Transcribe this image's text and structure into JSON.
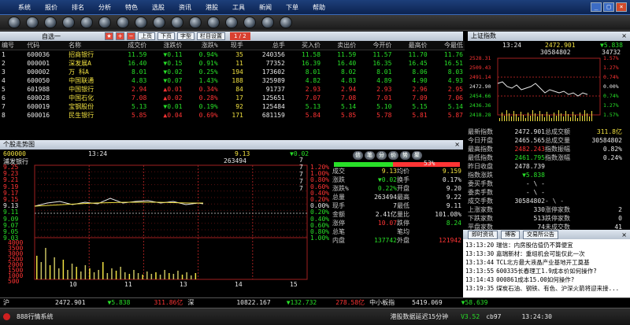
{
  "menu": [
    "系统",
    "报价",
    "排名",
    "分析",
    "特色",
    "选股",
    "资讯",
    "港股",
    "工具",
    "新闻",
    "下单",
    "帮助"
  ],
  "qtool": {
    "select": "自选一",
    "btn_up": "上页",
    "btn_down": "下页",
    "btn_font": "字型",
    "btn_cols": "栏目设置",
    "page": "1 / 2"
  },
  "quotes": {
    "headers": [
      "编号",
      "代码",
      "名称",
      "成交价",
      "涨跌价",
      "涨跌%",
      "现手",
      "总手",
      "买入价",
      "卖出价",
      "今开价",
      "最高价",
      "今最低"
    ],
    "rows": [
      {
        "no": "1",
        "code": "600036",
        "name": "招商银行",
        "price": "11.59",
        "chg": "▼0.11",
        "pct": "0.94%",
        "vol": "35",
        "total": "240356",
        "bid": "11.58",
        "ask": "11.59",
        "open": "11.57",
        "high": "11.70",
        "low": "11.76"
      },
      {
        "no": "2",
        "code": "000001",
        "name": "深发展A",
        "price": "16.40",
        "chg": "▼0.15",
        "pct": "0.91%",
        "vol": "11",
        "total": "77352",
        "bid": "16.39",
        "ask": "16.40",
        "open": "16.35",
        "high": "16.45",
        "low": "16.51"
      },
      {
        "no": "3",
        "code": "000002",
        "name": "万 科A",
        "price": "8.01",
        "chg": "▼0.02",
        "pct": "0.25%",
        "vol": "194",
        "total": "173602",
        "bid": "8.01",
        "ask": "8.02",
        "open": "8.01",
        "high": "8.06",
        "low": "8.03"
      },
      {
        "no": "4",
        "code": "600050",
        "name": "中国联通",
        "price": "4.83",
        "chg": "▼0.07",
        "pct": "1.43%",
        "vol": "188",
        "total": "325989",
        "bid": "4.82",
        "ask": "4.83",
        "open": "4.89",
        "high": "4.90",
        "low": "4.93"
      },
      {
        "no": "5",
        "code": "601988",
        "name": "中国银行",
        "price": "2.94",
        "chg": "▲0.01",
        "pct": "0.34%",
        "vol": "84",
        "total": "91737",
        "bid": "2.93",
        "ask": "2.94",
        "open": "2.93",
        "high": "2.96",
        "low": "2.95"
      },
      {
        "no": "6",
        "code": "600028",
        "name": "中国石化",
        "price": "7.08",
        "chg": "▲0.02",
        "pct": "0.28%",
        "vol": "17",
        "total": "125651",
        "bid": "7.07",
        "ask": "7.08",
        "open": "7.01",
        "high": "7.09",
        "low": "7.06"
      },
      {
        "no": "7",
        "code": "600019",
        "name": "宝钢股份",
        "price": "5.13",
        "chg": "▼0.01",
        "pct": "0.19%",
        "vol": "92",
        "total": "125484",
        "bid": "5.13",
        "ask": "5.14",
        "open": "5.10",
        "high": "5.15",
        "low": "5.14"
      },
      {
        "no": "8",
        "code": "600016",
        "name": "民生银行",
        "price": "5.85",
        "chg": "▲0.04",
        "pct": "0.69%",
        "vol": "171",
        "total": "681159",
        "bid": "5.84",
        "ask": "5.85",
        "open": "5.78",
        "high": "5.81",
        "low": "5.87"
      }
    ]
  },
  "mini": {
    "title": "个股走势图",
    "code": "600000",
    "name": "浦发银行",
    "time": "13:24",
    "price": "9.13",
    "vol": "263494",
    "chg": "▼0.02",
    "ylabels": [
      "9.25",
      "9.23",
      "9.21",
      "9.19",
      "9.17",
      "9.15",
      "9.13",
      "9.11",
      "9.09",
      "9.07",
      "9.05",
      "9.03"
    ],
    "pct_labels": [
      "1.20%",
      "1.00%",
      "0.80%",
      "0.60%",
      "0.40%",
      "0.20%",
      "0.00%",
      "0.20%",
      "0.40%",
      "0.60%",
      "0.80%",
      "1.00%"
    ],
    "vlabels": [
      "4000",
      "3500",
      "3000",
      "2500",
      "2000",
      "1500",
      "1000",
      "500"
    ],
    "xlabels": [
      "10",
      "11",
      "13",
      "14",
      "15"
    ],
    "num7": [
      "7",
      "7",
      "7",
      "7",
      "7"
    ]
  },
  "info": {
    "tabs": [
      "信",
      "笔",
      "分",
      "价",
      "势",
      "聚"
    ],
    "bar_pct": "53%",
    "rows": [
      [
        "成交",
        "9.13",
        "均价",
        "9.159"
      ],
      [
        "涨跌",
        "▼0.02",
        "换手",
        "0.17%"
      ],
      [
        "涨跌%",
        "0.22%",
        "开盘",
        "9.20"
      ],
      [
        "总量",
        "263494",
        "最高",
        "9.22"
      ],
      [
        "现手",
        "7",
        "最低",
        "9.11"
      ],
      [
        "金额",
        "2.41亿",
        "量比",
        "101.08%"
      ],
      [
        "涨停",
        "10.07",
        "跌停",
        "8.24"
      ],
      [
        "总笔",
        "",
        "笔均",
        ""
      ],
      [
        "内盘",
        "137742",
        "外盘",
        "121942"
      ]
    ]
  },
  "index": {
    "title": "上证指数",
    "time": "13:24",
    "value": "2472.901",
    "chg": "▼5.838",
    "vol1": "30584802",
    "vol2": "34732",
    "yl": [
      "2528.31",
      "2509.43",
      "2491.14",
      "2472.90",
      "2454.66",
      "2436.36",
      "2418.28"
    ],
    "yr": [
      "1.57%",
      "1.27%",
      "0.74%",
      "0.00%",
      "0.74%",
      "1.27%",
      "1.57%"
    ],
    "rows": [
      [
        "最新指数",
        "2472.901",
        "总成交额",
        "311.8亿"
      ],
      [
        "今日开盘",
        "2465.565",
        "总成交量",
        "30584802"
      ],
      [
        "最高指数",
        "2482.243",
        "指数振幅",
        "0.82%"
      ],
      [
        "最低指数",
        "2461.795",
        "指数涨幅",
        "0.24%"
      ],
      [
        "昨日收盘",
        "2478.739",
        "",
        ""
      ],
      [
        "指数涨跌",
        "▼5.838",
        "",
        ""
      ],
      [
        "委买手数",
        "- \\ -",
        "",
        ""
      ],
      [
        "委卖手数",
        "- \\ -",
        "",
        ""
      ],
      [
        "成交手数",
        "30584802",
        "- \\ -",
        ""
      ],
      [
        "上涨家数",
        "330",
        "涨停家数",
        "2"
      ],
      [
        "下跌家数",
        "513",
        "跌停家数",
        "0"
      ],
      [
        "平盘家数",
        "74",
        "未成交数",
        "41"
      ],
      [
        "总家数",
        "917",
        "总手数",
        "7"
      ]
    ]
  },
  "news": {
    "tabs": [
      "即时资讯",
      "博客",
      "交易所公告"
    ],
    "items": [
      [
        "13:13:20",
        "瑞信：内房股估值仍不算便宜"
      ],
      [
        "13:13:30",
        "嘉瑞新材：重组机会可能仅此一次"
      ],
      [
        "13:13:44",
        "TCL北方最大液晶产业基地开工奠基"
      ],
      [
        "13:13:55",
        "600335长春理工1.9成本价如何操作?"
      ],
      [
        "13:14:43",
        "000861成本15.00如何操作?"
      ],
      [
        "13:19:35",
        "煤炭石油、钢铁、有色、沪深火箭将迎来接..."
      ]
    ]
  },
  "status": {
    "sh": "沪",
    "sh_val": "2472.901",
    "sh_chg": "▼5.838",
    "sh_amt": "311.86亿",
    "sz": "深",
    "sz_val": "10822.167",
    "sz_chg": "▼132.732",
    "sz_amt": "278.58亿",
    "zx": "中小板指",
    "zx_val": "5419.069",
    "zx_chg": "▼58.639"
  },
  "bottom": {
    "sys": "888行情系统",
    "delay": "港股数据延迟15分钟",
    "ver": "V3.52",
    "code": "cb97",
    "clock": "13:24:30"
  }
}
